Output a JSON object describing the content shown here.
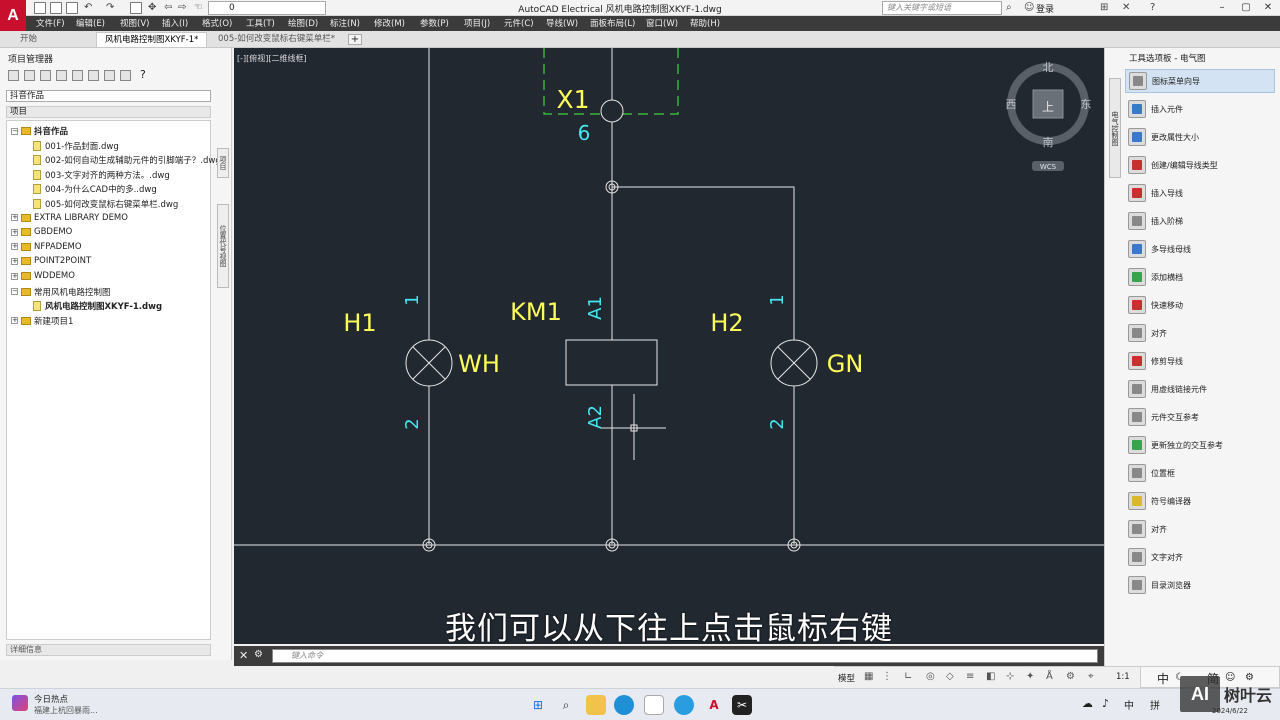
{
  "titlebar": {
    "app_logo": "A",
    "layer_value": "0",
    "window_title": "AutoCAD Electrical    风机电路控制图XKYF-1.dwg",
    "search_placeholder": "键入关键字或短语",
    "login_label": "登录"
  },
  "menu": [
    "文件(F)",
    "编辑(E)",
    "视图(V)",
    "插入(I)",
    "格式(O)",
    "工具(T)",
    "绘图(D)",
    "标注(N)",
    "修改(M)",
    "参数(P)",
    "项目(J)",
    "元件(C)",
    "导线(W)",
    "面板布局(L)",
    "窗口(W)",
    "帮助(H)"
  ],
  "tabs": [
    {
      "label": "开始"
    },
    {
      "label": "风机电路控制图XKYF-1*"
    },
    {
      "label": "005-如何改变鼠标右键菜单栏*"
    }
  ],
  "project_manager": {
    "title": "项目管理器",
    "selected_project": "抖音作品",
    "header": "项目",
    "tree": [
      {
        "label": "抖音作品",
        "level": 0,
        "type": "folder",
        "bold": true,
        "expanded": true
      },
      {
        "label": "001-作品封面.dwg",
        "level": 1,
        "type": "dwg"
      },
      {
        "label": "002-如何自动生成辅助元件的引脚端子？.dwg",
        "level": 1,
        "type": "dwg"
      },
      {
        "label": "003-文字对齐的两种方法。.dwg",
        "level": 1,
        "type": "dwg"
      },
      {
        "label": "004-为什么CAD中的多..dwg",
        "level": 1,
        "type": "dwg"
      },
      {
        "label": "005-如何改变鼠标右键菜单栏.dwg",
        "level": 1,
        "type": "dwg"
      },
      {
        "label": "EXTRA LIBRARY DEMO",
        "level": 0,
        "type": "folder"
      },
      {
        "label": "GBDEMO",
        "level": 0,
        "type": "folder"
      },
      {
        "label": "NFPADEMO",
        "level": 0,
        "type": "folder"
      },
      {
        "label": "POINT2POINT",
        "level": 0,
        "type": "folder"
      },
      {
        "label": "WDDEMO",
        "level": 0,
        "type": "folder"
      },
      {
        "label": "常用风机电路控制图",
        "level": 0,
        "type": "folder",
        "expanded": true
      },
      {
        "label": "风机电路控制图XKYF-1.dwg",
        "level": 1,
        "type": "dwg",
        "bold": true
      },
      {
        "label": "新建项目1",
        "level": 0,
        "type": "folder"
      }
    ],
    "side_tabs": [
      "项目",
      "位置代号视图"
    ],
    "detail_label": "详细信息"
  },
  "canvas": {
    "viewport_label": "[-][俯视][二维线框]",
    "background": "#212830",
    "compass": {
      "north": "北",
      "south": "南",
      "east": "东",
      "west": "西",
      "center": "上",
      "wcs": "WCS"
    },
    "labels": {
      "x1": "X1",
      "x1_pin": "6",
      "h1": "H1",
      "h1_pin_top": "1",
      "h1_pin_bottom": "2",
      "h1_color": "WH",
      "km1": "KM1",
      "km1_a1": "A1",
      "km1_a2": "A2",
      "h2": "H2",
      "h2_pin_top": "1",
      "h2_pin_bottom": "2",
      "h2_color": "GN"
    },
    "colors": {
      "yellow": "#ffff5a",
      "cyan": "#43e6f2",
      "line": "#e6e6e6",
      "green_dash": "#3cd23c"
    },
    "subtitle": "我们可以从下往上点击鼠标右键"
  },
  "command": {
    "placeholder": "键入命令"
  },
  "palette": {
    "title": "工具选项板 - 电气图",
    "side_tab": "电气控制图",
    "items": [
      {
        "label": "图标菜单向导",
        "icon": "wizard-icon",
        "color": "gray",
        "selected": true
      },
      {
        "label": "插入元件",
        "icon": "insert-component-icon",
        "color": "blue"
      },
      {
        "label": "更改属性大小",
        "icon": "attribute-size-icon",
        "color": "blue"
      },
      {
        "label": "创建/编辑导线类型",
        "icon": "wire-type-icon",
        "color": "red"
      },
      {
        "label": "插入导线",
        "icon": "insert-wire-icon",
        "color": "red"
      },
      {
        "label": "插入阶梯",
        "icon": "ladder-icon",
        "color": "gray"
      },
      {
        "label": "多导线母线",
        "icon": "multi-wire-bus-icon",
        "color": "blue"
      },
      {
        "label": "添加横档",
        "icon": "add-rung-icon",
        "color": "green"
      },
      {
        "label": "快速移动",
        "icon": "quick-move-icon",
        "color": "red"
      },
      {
        "label": "对齐",
        "icon": "align-icon",
        "color": "gray"
      },
      {
        "label": "修剪导线",
        "icon": "trim-wire-icon",
        "color": "red"
      },
      {
        "label": "用虚线链接元件",
        "icon": "dashed-link-icon",
        "color": "gray"
      },
      {
        "label": "元件交互参考",
        "icon": "cross-ref-icon",
        "color": "gray"
      },
      {
        "label": "更新独立的交互参考",
        "icon": "update-cross-ref-icon",
        "color": "green"
      },
      {
        "label": "位置框",
        "icon": "location-box-icon",
        "color": "gray"
      },
      {
        "label": "符号编译器",
        "icon": "symbol-builder-icon",
        "color": "yellow"
      },
      {
        "label": "对齐",
        "icon": "align-text-icon",
        "color": "gray"
      },
      {
        "label": "文字对齐",
        "icon": "text-align-icon",
        "color": "gray"
      },
      {
        "label": "目录浏览器",
        "icon": "catalog-browser-icon",
        "color": "gray"
      }
    ]
  },
  "statusbar": {
    "model_label": "模型",
    "scale_label": "1:1"
  },
  "ime": {
    "chars": [
      "中",
      "简"
    ]
  },
  "taskbar": {
    "news_title": "今日热点",
    "news_sub": "福建上杭回暴雨...",
    "tray_ime": "中",
    "tray_pin": "拼",
    "date": "2024/6/22"
  },
  "watermark": {
    "logo": "AI",
    "text": "树叶云"
  }
}
